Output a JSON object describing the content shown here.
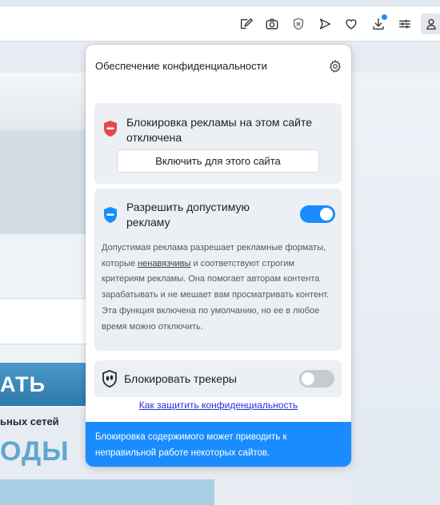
{
  "toolbar": {
    "icons": [
      "edit-icon",
      "camera-icon",
      "privacy-shield-icon",
      "send-icon",
      "heart-icon",
      "download-icon",
      "sliders-icon",
      "profile-icon"
    ]
  },
  "background_page": {
    "button_fragment": "АТЬ",
    "social_fragment": "ьных сетей",
    "big_fragment": "ОДЫ"
  },
  "panel": {
    "title": "Обеспечение конфиденциальности",
    "ad_block": {
      "title": "Блокировка рекламы на этом сайте отключена",
      "enable_button": "Включить для этого сайта",
      "status_color": "#e5484d"
    },
    "acceptable_ads": {
      "title": "Разрешить допустимую рекламу",
      "enabled": true,
      "desc_part1": "Допустимая реклама разрешает рекламные форматы, которые ",
      "desc_link": "ненавязчивы",
      "desc_part2": " и соответствуют строгим критериям рекламы. Она помогает авторам контента зарабатывать и не мешает вам просматривать контент. Эта функция включена по умолчанию, но ее в любое время можно отключить."
    },
    "trackers": {
      "title": "Блокировать трекеры",
      "enabled": false
    },
    "privacy_link": "Как защитить конфиденциальность",
    "notice": "Блокировка содержимого может приводить к неправильной работе некоторых сайтов."
  },
  "colors": {
    "accent": "#1a8cff",
    "danger": "#e5484d"
  }
}
